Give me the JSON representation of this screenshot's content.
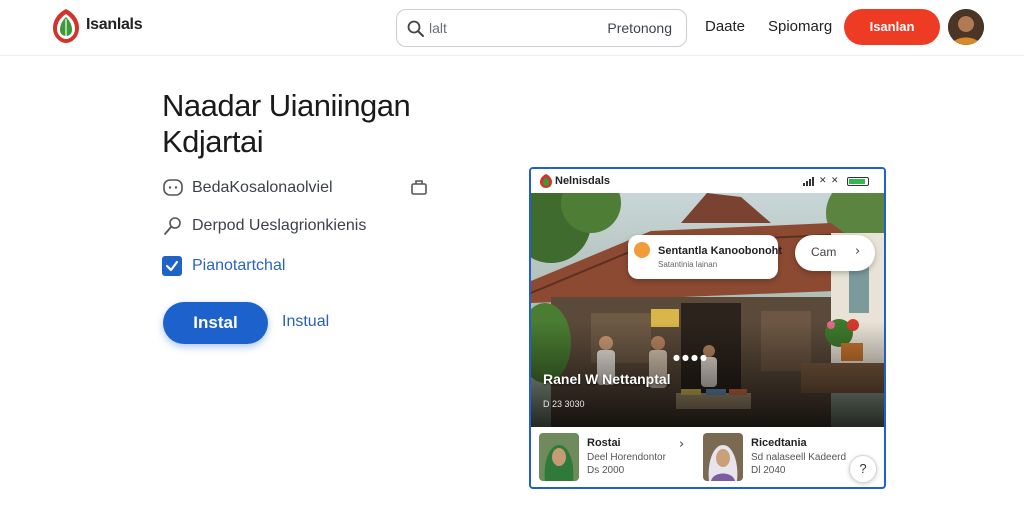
{
  "nav": {
    "brand": "Isanlals",
    "search_placeholder": "lalt",
    "search_value": "Pretonong",
    "links": [
      "Daate",
      "Spiomarg"
    ],
    "cta_label": "Isanlan"
  },
  "hero": {
    "title": "Naadar Uianiingan Kdjartai",
    "items": [
      {
        "label": "BedaKosalonaolviel",
        "icon": "message-icon"
      },
      {
        "label": "Derpod Ueslagrionkienis",
        "icon": "location-pin-icon"
      },
      {
        "label": "Pianotartchal",
        "icon": "checkbox-icon"
      }
    ],
    "install_button": "Instal",
    "install_link": "Instual"
  },
  "phone": {
    "app_name": "Nelnisdals",
    "overlay_card": {
      "title": "Sentantla Kanoobonoht",
      "subtitle": "Satantinia lainan"
    },
    "overlay_button": "Cam",
    "photo_title": "Ranel W Nettanptal",
    "photo_meta": "D 23 3030",
    "list": [
      {
        "name": "Rostai",
        "line1": "Deel Horendontor",
        "line2": "Ds 2000"
      },
      {
        "name": "Ricedtania",
        "line1": "Sd nalaseell Kadeerd",
        "line2": "Dl 2040"
      }
    ],
    "help_label": "?"
  },
  "colors": {
    "accent_blue": "#1d62cc",
    "cta_red": "#ee3b24",
    "phone_border": "#1f5fd0",
    "battery_green": "#2dbb4a"
  }
}
